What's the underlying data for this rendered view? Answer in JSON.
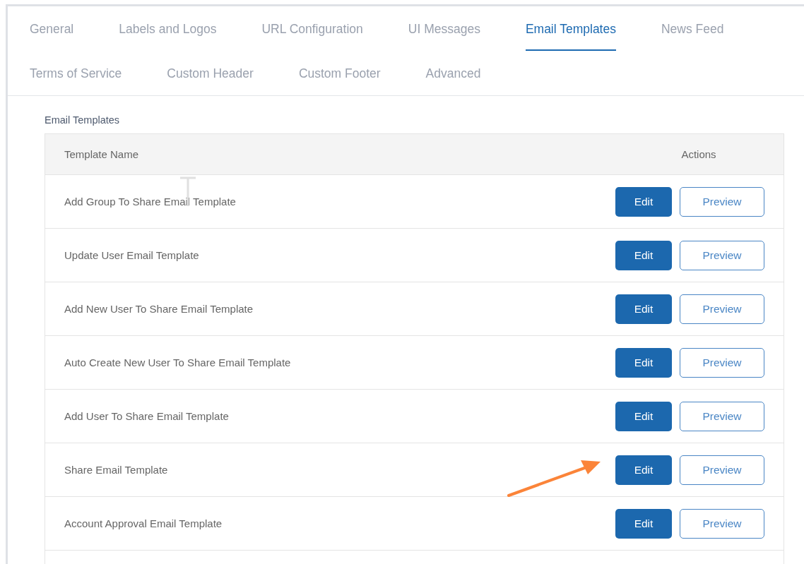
{
  "tabs": [
    {
      "label": "General",
      "selected": false
    },
    {
      "label": "Labels and Logos",
      "selected": false
    },
    {
      "label": "URL Configuration",
      "selected": false
    },
    {
      "label": "UI Messages",
      "selected": false
    },
    {
      "label": "Email Templates",
      "selected": true
    },
    {
      "label": "News Feed",
      "selected": false
    },
    {
      "label": "Terms of Service",
      "selected": false
    },
    {
      "label": "Custom Header",
      "selected": false
    },
    {
      "label": "Custom Footer",
      "selected": false
    },
    {
      "label": "Advanced",
      "selected": false
    }
  ],
  "section_title": "Email Templates",
  "table": {
    "columns": [
      "Template Name",
      "Actions"
    ],
    "rows": [
      {
        "name": "Add Group To Share Email Template",
        "actions": [
          "Edit",
          "Preview"
        ]
      },
      {
        "name": "Update User Email Template",
        "actions": [
          "Edit",
          "Preview"
        ]
      },
      {
        "name": "Add New User To Share Email Template",
        "actions": [
          "Edit",
          "Preview"
        ]
      },
      {
        "name": "Auto Create New User To Share Email Template",
        "actions": [
          "Edit",
          "Preview"
        ]
      },
      {
        "name": "Add User To Share Email Template",
        "actions": [
          "Edit",
          "Preview"
        ]
      },
      {
        "name": "Share Email Template",
        "actions": [
          "Edit",
          "Preview"
        ]
      },
      {
        "name": "Account Approval Email Template",
        "actions": [
          "Edit",
          "Preview"
        ]
      }
    ]
  }
}
